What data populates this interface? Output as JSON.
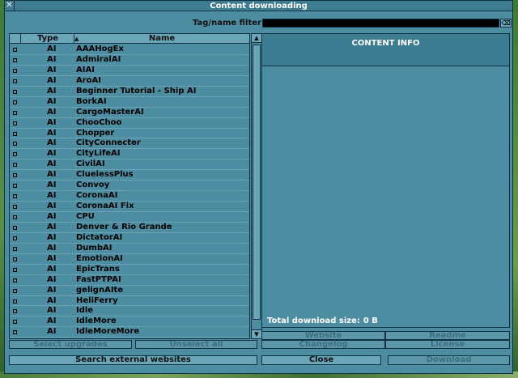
{
  "window": {
    "title": "Content downloading",
    "close_glyph": "✕"
  },
  "filter": {
    "label": "Tag/name filter:",
    "value": "",
    "clear_glyph": "⌫"
  },
  "list": {
    "columns": {
      "type": "Type",
      "name": "Name",
      "sort_indicator": "▲"
    },
    "rows": [
      {
        "type": "AI",
        "name": "AAAHogEx"
      },
      {
        "type": "AI",
        "name": "AdmiralAI"
      },
      {
        "type": "AI",
        "name": "AIAI"
      },
      {
        "type": "AI",
        "name": "AroAI"
      },
      {
        "type": "AI",
        "name": "Beginner Tutorial - Ship AI"
      },
      {
        "type": "AI",
        "name": "BorkAI"
      },
      {
        "type": "AI",
        "name": "CargoMasterAI"
      },
      {
        "type": "AI",
        "name": "ChooChoo"
      },
      {
        "type": "AI",
        "name": "Chopper"
      },
      {
        "type": "AI",
        "name": "CityConnecter"
      },
      {
        "type": "AI",
        "name": "CityLifeAI"
      },
      {
        "type": "AI",
        "name": "CivilAI"
      },
      {
        "type": "AI",
        "name": "CluelessPlus"
      },
      {
        "type": "AI",
        "name": "Convoy"
      },
      {
        "type": "AI",
        "name": "CoronaAI"
      },
      {
        "type": "AI",
        "name": "CoronaAI Fix"
      },
      {
        "type": "AI",
        "name": "CPU"
      },
      {
        "type": "AI",
        "name": "Denver & Rio Grande"
      },
      {
        "type": "AI",
        "name": "DictatorAI"
      },
      {
        "type": "AI",
        "name": "DumbAI"
      },
      {
        "type": "AI",
        "name": "EmotionAI"
      },
      {
        "type": "AI",
        "name": "EpicTrans"
      },
      {
        "type": "AI",
        "name": "FastPTPAI"
      },
      {
        "type": "AI",
        "name": "gelignAIte"
      },
      {
        "type": "AI",
        "name": "HeliFerry"
      },
      {
        "type": "AI",
        "name": "Idle"
      },
      {
        "type": "AI",
        "name": "IdleMore"
      },
      {
        "type": "AI",
        "name": "IdleMoreMore"
      }
    ]
  },
  "scroll": {
    "up_glyph": "▲",
    "down_glyph": "▼"
  },
  "info": {
    "header": "CONTENT INFO",
    "total_label": "Total download size:",
    "total_value": "0 B"
  },
  "buttons": {
    "website": "Website",
    "readme": "Readme",
    "changelog": "Changelog",
    "license": "License",
    "select_upgrades": "Select upgrades",
    "unselect_all": "Unselect all",
    "search_external": "Search external websites",
    "close": "Close",
    "download": "Download"
  },
  "colors": {
    "window_bg": "#4d8da2",
    "panel_dark": "#3e7c92",
    "button": "#6aa6b8",
    "border": "#0e3040"
  }
}
